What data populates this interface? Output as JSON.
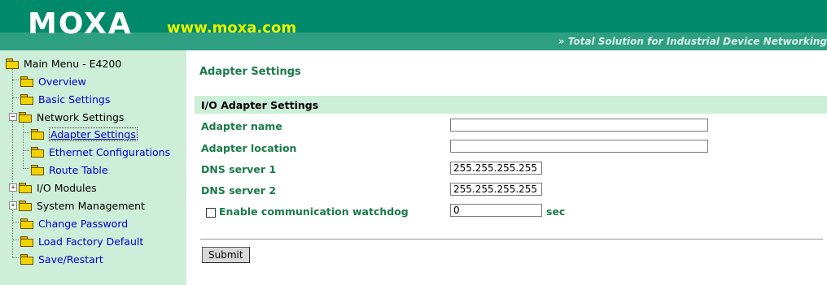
{
  "header": {
    "logo": "MOXA",
    "url": "www.moxa.com",
    "tagline": "» Total Solution for Industrial Device Networking"
  },
  "sidebar": {
    "items": [
      {
        "label": "Main Menu - E4200",
        "icon": "folder-open-icon"
      },
      {
        "label": "Overview",
        "icon": "folder-icon"
      },
      {
        "label": "Basic Settings",
        "icon": "folder-icon"
      },
      {
        "label": "Network Settings",
        "icon": "folder-open-icon",
        "expander": "−"
      },
      {
        "label": "Adapter Settings",
        "icon": "folder-icon",
        "selected": true
      },
      {
        "label": "Ethernet Configurations",
        "icon": "folder-icon"
      },
      {
        "label": "Route Table",
        "icon": "folder-icon"
      },
      {
        "label": "I/O Modules",
        "icon": "folder-icon",
        "expander": "+"
      },
      {
        "label": "System Management",
        "icon": "folder-icon",
        "expander": "+"
      },
      {
        "label": "Change Password",
        "icon": "folder-icon"
      },
      {
        "label": "Load Factory Default",
        "icon": "folder-icon"
      },
      {
        "label": "Save/Restart",
        "icon": "folder-icon"
      }
    ]
  },
  "main": {
    "page_title": "Adapter Settings",
    "section_title": "I/O Adapter Settings",
    "fields": [
      {
        "label": "Adapter name",
        "value": ""
      },
      {
        "label": "Adapter location",
        "value": ""
      },
      {
        "label": "DNS server 1",
        "value": "255.255.255.255"
      },
      {
        "label": "DNS server 2",
        "value": "255.255.255.255"
      }
    ],
    "watchdog": {
      "label": "Enable communication watchdog",
      "checked": false,
      "value": "0",
      "unit": "sec"
    },
    "submit_label": "Submit"
  },
  "colors": {
    "header_bg": "#008a6a",
    "url_color": "#e6f400",
    "sidebar_bg": "#cdeed8",
    "label_green": "#1a7a4a",
    "link_blue": "#0000cc"
  }
}
